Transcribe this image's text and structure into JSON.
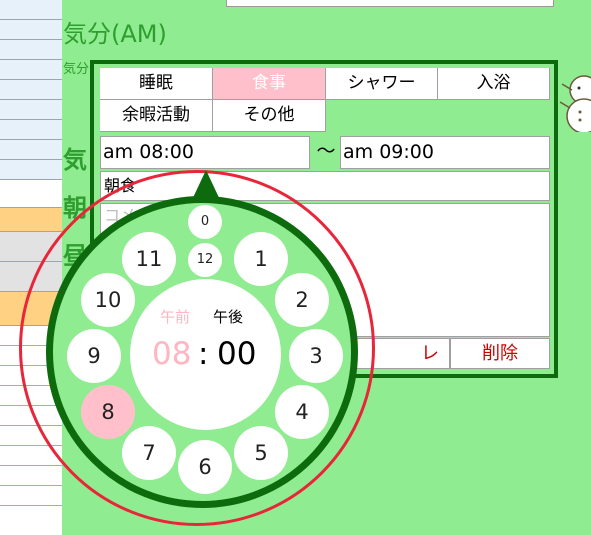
{
  "background": {
    "heading_am": "気分(AM)",
    "sub_fragment": "気分",
    "frag_a": "気",
    "frag_b": "朝",
    "frag_c": "昼"
  },
  "popup": {
    "tabs": [
      "睡眠",
      "食事",
      "シャワー",
      "入浴",
      "余暇活動",
      "その他"
    ],
    "active_tab_index": 1,
    "time_start": "am 08:00",
    "time_separator": "～",
    "time_end": "am 09:00",
    "title_value": "朝食",
    "comment_placeholder": "コメ",
    "partial_button": "レ",
    "delete_button": "削除"
  },
  "dial": {
    "hours": [
      "1",
      "2",
      "3",
      "4",
      "5",
      "6",
      "7",
      "8",
      "9",
      "10",
      "11"
    ],
    "inner_labels": [
      "0",
      "12"
    ],
    "selected_hour": "8",
    "ampm_am": "午前",
    "ampm_pm": "午後",
    "selected_period": "午前",
    "display_hour": "08",
    "display_colon": ":",
    "display_minute": "00"
  },
  "colors": {
    "background": "#90ec90",
    "dark_green": "#0d6b0d",
    "pink": "#ffc0cb",
    "red_ring": "#e8263a",
    "delete_text": "#cc0000"
  },
  "icons": [
    "snowman-icon",
    "pointer-triangle-icon"
  ]
}
